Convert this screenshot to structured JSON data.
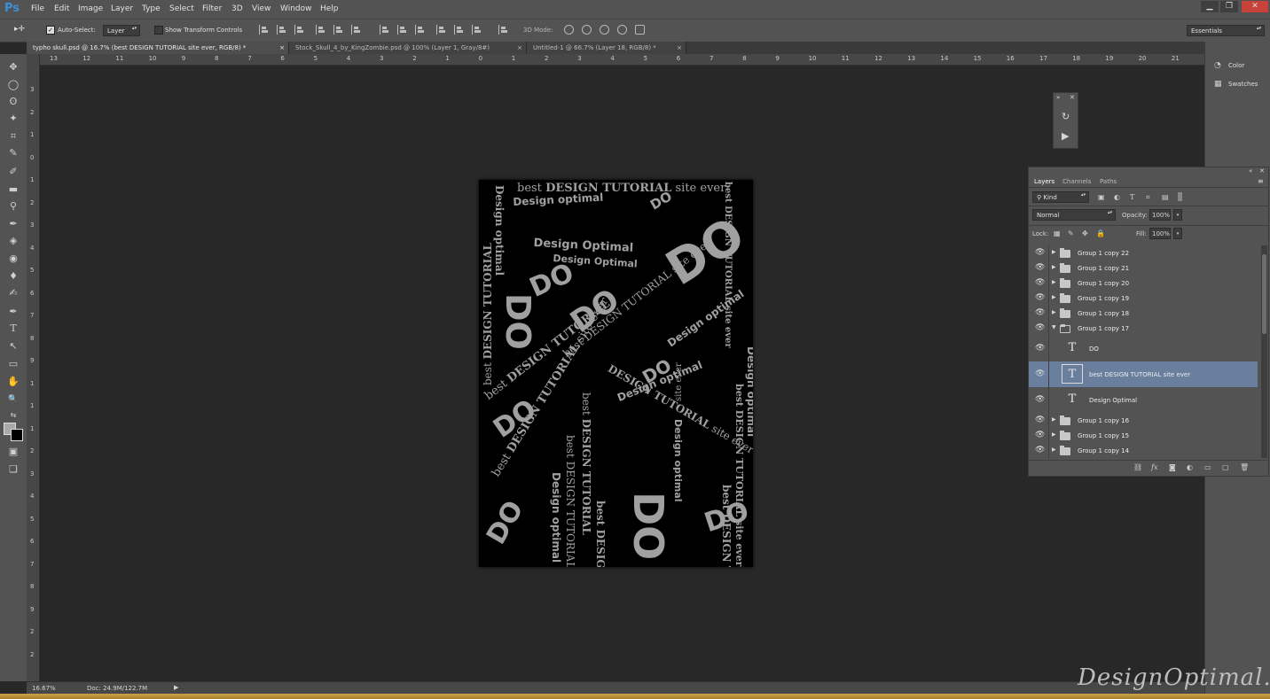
{
  "app": {
    "logo": "Ps"
  },
  "menu": [
    "File",
    "Edit",
    "Image",
    "Layer",
    "Type",
    "Select",
    "Filter",
    "3D",
    "View",
    "Window",
    "Help"
  ],
  "window_controls": {
    "minimize": "▁",
    "restore": "❐",
    "close": "✕"
  },
  "options_bar": {
    "tool_glyph": "▸✛",
    "auto_select_label": "Auto-Select:",
    "auto_select_checked": true,
    "auto_select_target": "Layer",
    "transform_controls_label": "Show Transform Controls",
    "mode_3d_label": "3D Mode:",
    "workspace": "Essentials"
  },
  "tabs": [
    {
      "label": "typho skull.psd @ 16.7% (best DESIGN TUTORIAL site ever, RGB/8) *",
      "active": true
    },
    {
      "label": "Stock_Skull_4_by_KingZombie.psd @ 100% (Layer 1, Gray/8#)",
      "active": false
    },
    {
      "label": "Untitled-1 @ 66.7% (Layer 18, RGB/8) *",
      "active": false
    }
  ],
  "ruler": {
    "horizontal": [
      "13",
      "12",
      "11",
      "10",
      "9",
      "8",
      "7",
      "6",
      "5",
      "4",
      "3",
      "2",
      "1",
      "0",
      "1",
      "2",
      "3",
      "4",
      "5",
      "6",
      "7",
      "8",
      "9",
      "10",
      "11",
      "12",
      "13",
      "14",
      "15",
      "16",
      "17",
      "18",
      "19",
      "20",
      "21"
    ],
    "vertical": [
      "3",
      "2",
      "1",
      "0",
      "1",
      "2",
      "3",
      "4",
      "5",
      "6",
      "7",
      "8",
      "9",
      "1",
      "1",
      "1",
      "2",
      "3",
      "4",
      "5",
      "6",
      "7",
      "8",
      "9",
      "2",
      "2"
    ]
  },
  "tools": [
    "✥",
    "◯",
    "ʘ",
    "✦",
    "⌗",
    "✎",
    "✐",
    "▬",
    "⚲",
    "✒",
    "◈",
    "◉",
    "♦",
    "✍",
    "T",
    "↖",
    "▭",
    "✋",
    "🔍",
    "⇆",
    "▣",
    "▢",
    "❏"
  ],
  "artwork": {
    "tagline_lower": "best",
    "tagline_bold": "DESIGN TUTORIAL",
    "tagline_end": "site ever",
    "brand": "Design optimal",
    "brand_alt": "Design Optimal",
    "initials": "DO",
    "full_line": "best DESIGN TUTORIAL site ever"
  },
  "status": {
    "zoom": "16.67%",
    "doc": "Doc: 24.9M/122.7M",
    "arrow": "▶"
  },
  "dock": {
    "items": [
      {
        "label": "Color",
        "icon": "palette-icon",
        "glyph": "◔"
      },
      {
        "label": "Swatches",
        "icon": "swatches-icon",
        "glyph": "▦"
      }
    ]
  },
  "mini_panel": {
    "collapse": "»",
    "close": "✕",
    "play": "▶",
    "history": "↻"
  },
  "layers_panel": {
    "collapse": "«",
    "close": "✕",
    "menu": "≡",
    "tabs": [
      "Layers",
      "Channels",
      "Paths"
    ],
    "filter_kind": "Kind",
    "blend_mode": "Normal",
    "opacity_label": "Opacity:",
    "opacity_value": "100%",
    "lock_label": "Lock:",
    "fill_label": "Fill:",
    "fill_value": "100%",
    "layers": [
      {
        "name": "Group 1 copy 22",
        "type": "group",
        "open": false,
        "selected": false
      },
      {
        "name": "Group 1 copy 21",
        "type": "group",
        "open": false,
        "selected": false
      },
      {
        "name": "Group 1 copy 20",
        "type": "group",
        "open": false,
        "selected": false
      },
      {
        "name": "Group 1 copy 19",
        "type": "group",
        "open": false,
        "selected": false
      },
      {
        "name": "Group 1 copy 18",
        "type": "group",
        "open": false,
        "selected": false
      },
      {
        "name": "Group 1 copy 17",
        "type": "group",
        "open": true,
        "selected": false
      },
      {
        "name": "DO",
        "type": "text",
        "selected": false
      },
      {
        "name": "best DESIGN TUTORIAL site ever",
        "type": "text",
        "selected": true
      },
      {
        "name": "Design Optimal",
        "type": "text",
        "selected": false
      },
      {
        "name": "Group 1 copy 16",
        "type": "group",
        "open": false,
        "selected": false
      },
      {
        "name": "Group 1 copy 15",
        "type": "group",
        "open": false,
        "selected": false
      },
      {
        "name": "Group 1 copy 14",
        "type": "group",
        "open": false,
        "selected": false
      }
    ],
    "footer_icons": [
      "⛓",
      "fx",
      "◙",
      "◐",
      "▭",
      "▢",
      "🗑"
    ]
  },
  "watermark": "DesignOptimal.com"
}
